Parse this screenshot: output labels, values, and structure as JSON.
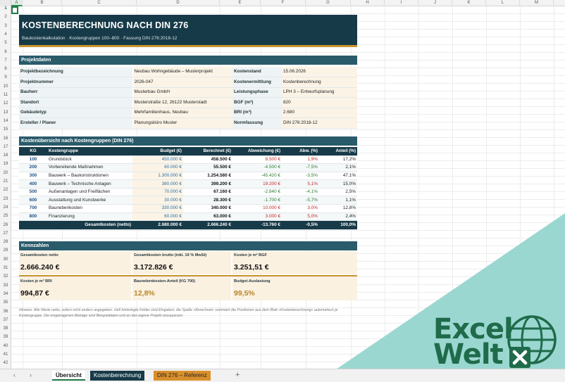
{
  "columns": [
    "A",
    "B",
    "C",
    "D",
    "E",
    "F",
    "G",
    "H",
    "I",
    "J",
    "K",
    "L",
    "M",
    "N",
    "O",
    "P"
  ],
  "rows": [
    "1",
    "2",
    "3",
    "4",
    "5",
    "6",
    "7",
    "8",
    "9",
    "10",
    "11",
    "12",
    "13",
    "14",
    "15",
    "16",
    "17",
    "18",
    "19",
    "20",
    "21",
    "22",
    "23",
    "24",
    "25",
    "26",
    "27",
    "28",
    "29",
    "30",
    "31",
    "32",
    "33",
    "34",
    "35",
    "36",
    "37",
    "38",
    "39",
    "40",
    "41",
    "42"
  ],
  "title": "KOSTENBERECHNUNG NACH DIN 276",
  "subtitle": "Baukostenkalkulation · Kostengruppen 100–800 · Fassung DIN 276:2018-12",
  "project": {
    "header": "Projektdaten",
    "rows": [
      {
        "l1": "Projektbezeichnung",
        "v1": "Neubau Wohngebäude – Musterprojekt",
        "l2": "Kostenstand",
        "v2": "15.06.2026"
      },
      {
        "l1": "Projektnummer",
        "v1": "2026-047",
        "l2": "Kostenermittlung",
        "v2": "Kostenberechnung"
      },
      {
        "l1": "Bauherr",
        "v1": "Musterbau GmbH",
        "l2": "Leistungsphase",
        "v2": "LPH 3 – Entwurfsplanung"
      },
      {
        "l1": "Standort",
        "v1": "Musterstraße 12, 26122 Musterstadt",
        "l2": "BGF (m²)",
        "v2": "820"
      },
      {
        "l1": "Gebäudetyp",
        "v1": "Mehrfamilienhaus, Neubau",
        "l2": "BRI (m³)",
        "v2": "2.680"
      },
      {
        "l1": "Ersteller / Planer",
        "v1": "Planungsbüro Muster",
        "l2": "Normfassung",
        "v2": "DIN 276:2018-12"
      }
    ]
  },
  "costs": {
    "header": "Kostenübersicht nach Kostengruppen (DIN 276)",
    "columns": {
      "kg": "KG",
      "group": "Kostengruppe",
      "budget": "Budget (€)",
      "calc": "Berechnet (€)",
      "dev": "Abweichung (€)",
      "devp": "Abw. (%)",
      "share": "Anteil (%)"
    },
    "rows": [
      {
        "kg": "100",
        "group": "Grundstück",
        "budget": "450.000 €",
        "calc": "458.500 €",
        "dev": "8.500 €",
        "devp": "1,9%",
        "share": "17,2%",
        "sign": "pos"
      },
      {
        "kg": "200",
        "group": "Vorbereitende Maßnahmen",
        "budget": "60.000 €",
        "calc": "55.500 €",
        "dev": "-4.500 €",
        "devp": "-7,5%",
        "share": "2,1%",
        "sign": "neg"
      },
      {
        "kg": "300",
        "group": "Bauwerk – Baukonstruktionen",
        "budget": "1.300.000 €",
        "calc": "1.254.580 €",
        "dev": "-45.420 €",
        "devp": "-3,5%",
        "share": "47,1%",
        "sign": "neg"
      },
      {
        "kg": "400",
        "group": "Bauwerk – Technische Anlagen",
        "budget": "380.000 €",
        "calc": "399.200 €",
        "dev": "19.200 €",
        "devp": "5,1%",
        "share": "15,0%",
        "sign": "pos"
      },
      {
        "kg": "500",
        "group": "Außenanlagen und Freiflächen",
        "budget": "70.000 €",
        "calc": "67.160 €",
        "dev": "-2.840 €",
        "devp": "-4,1%",
        "share": "2,5%",
        "sign": "neg"
      },
      {
        "kg": "600",
        "group": "Ausstattung und Kunstwerke",
        "budget": "30.000 €",
        "calc": "28.300 €",
        "dev": "-1.700 €",
        "devp": "-5,7%",
        "share": "1,1%",
        "sign": "neg"
      },
      {
        "kg": "700",
        "group": "Baunebenkosten",
        "budget": "330.000 €",
        "calc": "340.000 €",
        "dev": "10.000 €",
        "devp": "3,0%",
        "share": "12,8%",
        "sign": "pos"
      },
      {
        "kg": "800",
        "group": "Finanzierung",
        "budget": "60.000 €",
        "calc": "63.000 €",
        "dev": "3.000 €",
        "devp": "5,0%",
        "share": "2,4%",
        "sign": "pos"
      }
    ],
    "total": {
      "label": "Gesamtkosten (netto)",
      "budget": "2.680.000 €",
      "calc": "2.666.240 €",
      "dev": "-13.760 €",
      "devp": "-0,5%",
      "share": "100,0%"
    }
  },
  "kpis": {
    "header": "Kennzahlen",
    "items": [
      {
        "label": "Gesamtkosten netto",
        "value": "2.666.240 €"
      },
      {
        "label": "Gesamtkosten brutto (inkl. 19 % MwSt)",
        "value": "3.172.826 €"
      },
      {
        "label": "Kosten je m² BGF",
        "value": "3.251,51 €"
      },
      {
        "label": "Kosten je m³ BRI",
        "value": "994,87 €"
      },
      {
        "label": "Baunebenkosten-Anteil (KG 700)",
        "value": "12,8%"
      },
      {
        "label": "Budget-Auslastung",
        "value": "99,5%"
      }
    ]
  },
  "note": "Hinweis: Alle Werte netto, sofern nicht anders angegeben. Hell hinterlegte Felder sind Eingaben; die Spalte »Berechnet« summiert die Positionen aus dem Blatt »Kostenberechnung« automatisch je Kostengruppe. Die eingetragenen Beträge sind Beispieldaten und an das eigene Projekt anzupassen.",
  "logo": {
    "line1": "Excel",
    "line2": "Welt"
  },
  "tabs": [
    "Übersicht",
    "Kostenberechnung",
    "DIN 276 – Referenz"
  ],
  "nav": {
    "prev": "‹",
    "next": "›",
    "add": "+"
  }
}
